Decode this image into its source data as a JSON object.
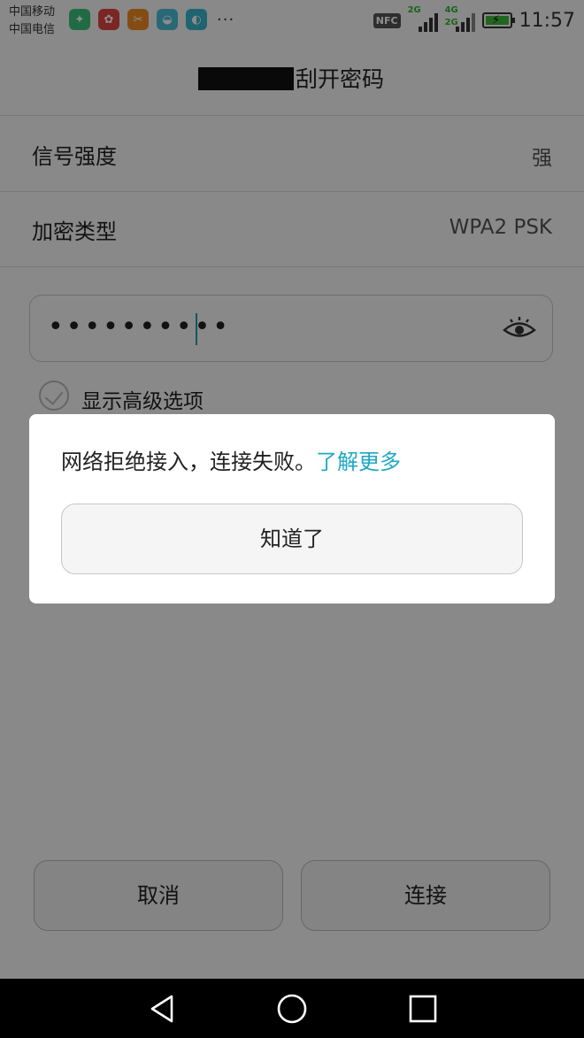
{
  "status_bar": {
    "carrier_1": "中国移动",
    "carrier_2": "中国电信",
    "more": "···",
    "nfc": "NFC",
    "net_1": "2G",
    "net_2a": "4G",
    "net_2b": "2G",
    "time": "11:57"
  },
  "header": {
    "title_suffix": "刮开密码"
  },
  "rows": [
    {
      "label": "信号强度",
      "value": "强"
    },
    {
      "label": "加密类型",
      "value": "WPA2 PSK"
    }
  ],
  "password": {
    "masked": "••••••••••"
  },
  "advanced": {
    "label": "显示高级选项"
  },
  "buttons": {
    "cancel": "取消",
    "connect": "连接"
  },
  "dialog": {
    "message": "网络拒绝接入，连接失败。",
    "link": "了解更多",
    "ok": "知道了"
  },
  "colors": {
    "accent": "#1fa7c4"
  }
}
